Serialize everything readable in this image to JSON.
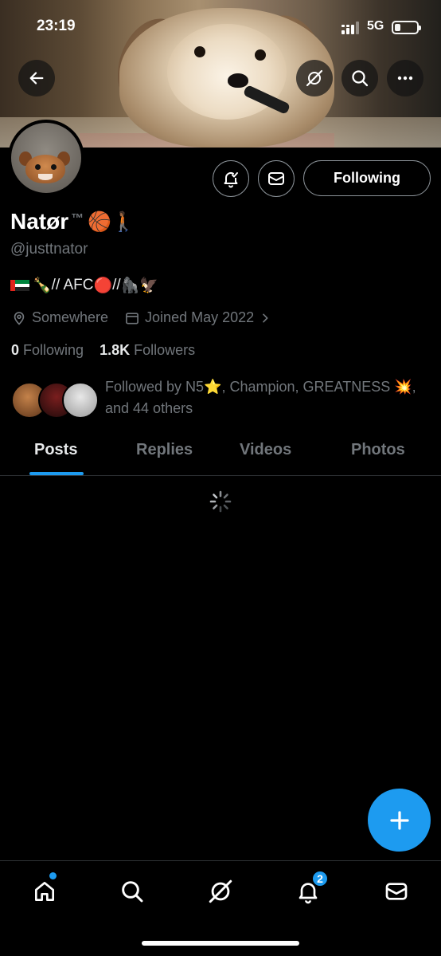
{
  "status_bar": {
    "time": "23:19",
    "network": "5G"
  },
  "profile": {
    "name": "Natør",
    "name_suffix": "™",
    "name_emojis": "🏀🚶🏾",
    "handle": "@justtnator",
    "bio_emojis_1": "🍾",
    "bio_text_1": "// AFC",
    "bio_emojis_2": "🔴",
    "bio_text_2": "//",
    "bio_emojis_3": "🦍🦅",
    "location": "Somewhere",
    "joined": "Joined May 2022",
    "following_count": "0",
    "following_label": "Following",
    "followers_count": "1.8K",
    "followers_label": "Followers",
    "followed_by": "Followed by N5⭐, Champion, GREATNESS 💥, and 44 others"
  },
  "actions": {
    "following_label": "Following"
  },
  "tabs": [
    {
      "label": "Posts",
      "active": true
    },
    {
      "label": "Replies",
      "active": false
    },
    {
      "label": "Videos",
      "active": false
    },
    {
      "label": "Photos",
      "active": false
    }
  ],
  "nav": {
    "notifications_badge": "2",
    "items": [
      "home-icon",
      "search-icon",
      "grok-icon",
      "bell-icon",
      "mail-icon"
    ]
  },
  "colors": {
    "accent": "#1d9bf0",
    "background": "#000000",
    "muted": "#71767b"
  }
}
